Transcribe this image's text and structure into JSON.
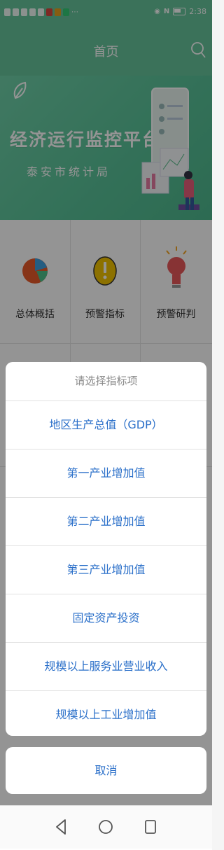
{
  "status_bar": {
    "time": "2:38"
  },
  "nav": {
    "title": "首页"
  },
  "banner": {
    "title": "经济运行监控平台",
    "subtitle": "泰安市统计局"
  },
  "grid": {
    "items": [
      {
        "label": "总体概括",
        "icon": "pie-chart-icon"
      },
      {
        "label": "预警指标",
        "icon": "warning-coin-icon"
      },
      {
        "label": "预警研判",
        "icon": "lightbulb-icon"
      }
    ]
  },
  "picker": {
    "title": "请选择指标项",
    "options": [
      "地区生产总值（GDP）",
      "第一产业增加值",
      "第二产业增加值",
      "第三产业增加值",
      "固定资产投资",
      "规模以上服务业营业收入",
      "规模以上工业增加值"
    ],
    "cancel": "取消"
  },
  "colors": {
    "primary": "#67c59b",
    "link": "#2a6fc9",
    "overlay": "rgba(0,0,0,0.42)"
  }
}
